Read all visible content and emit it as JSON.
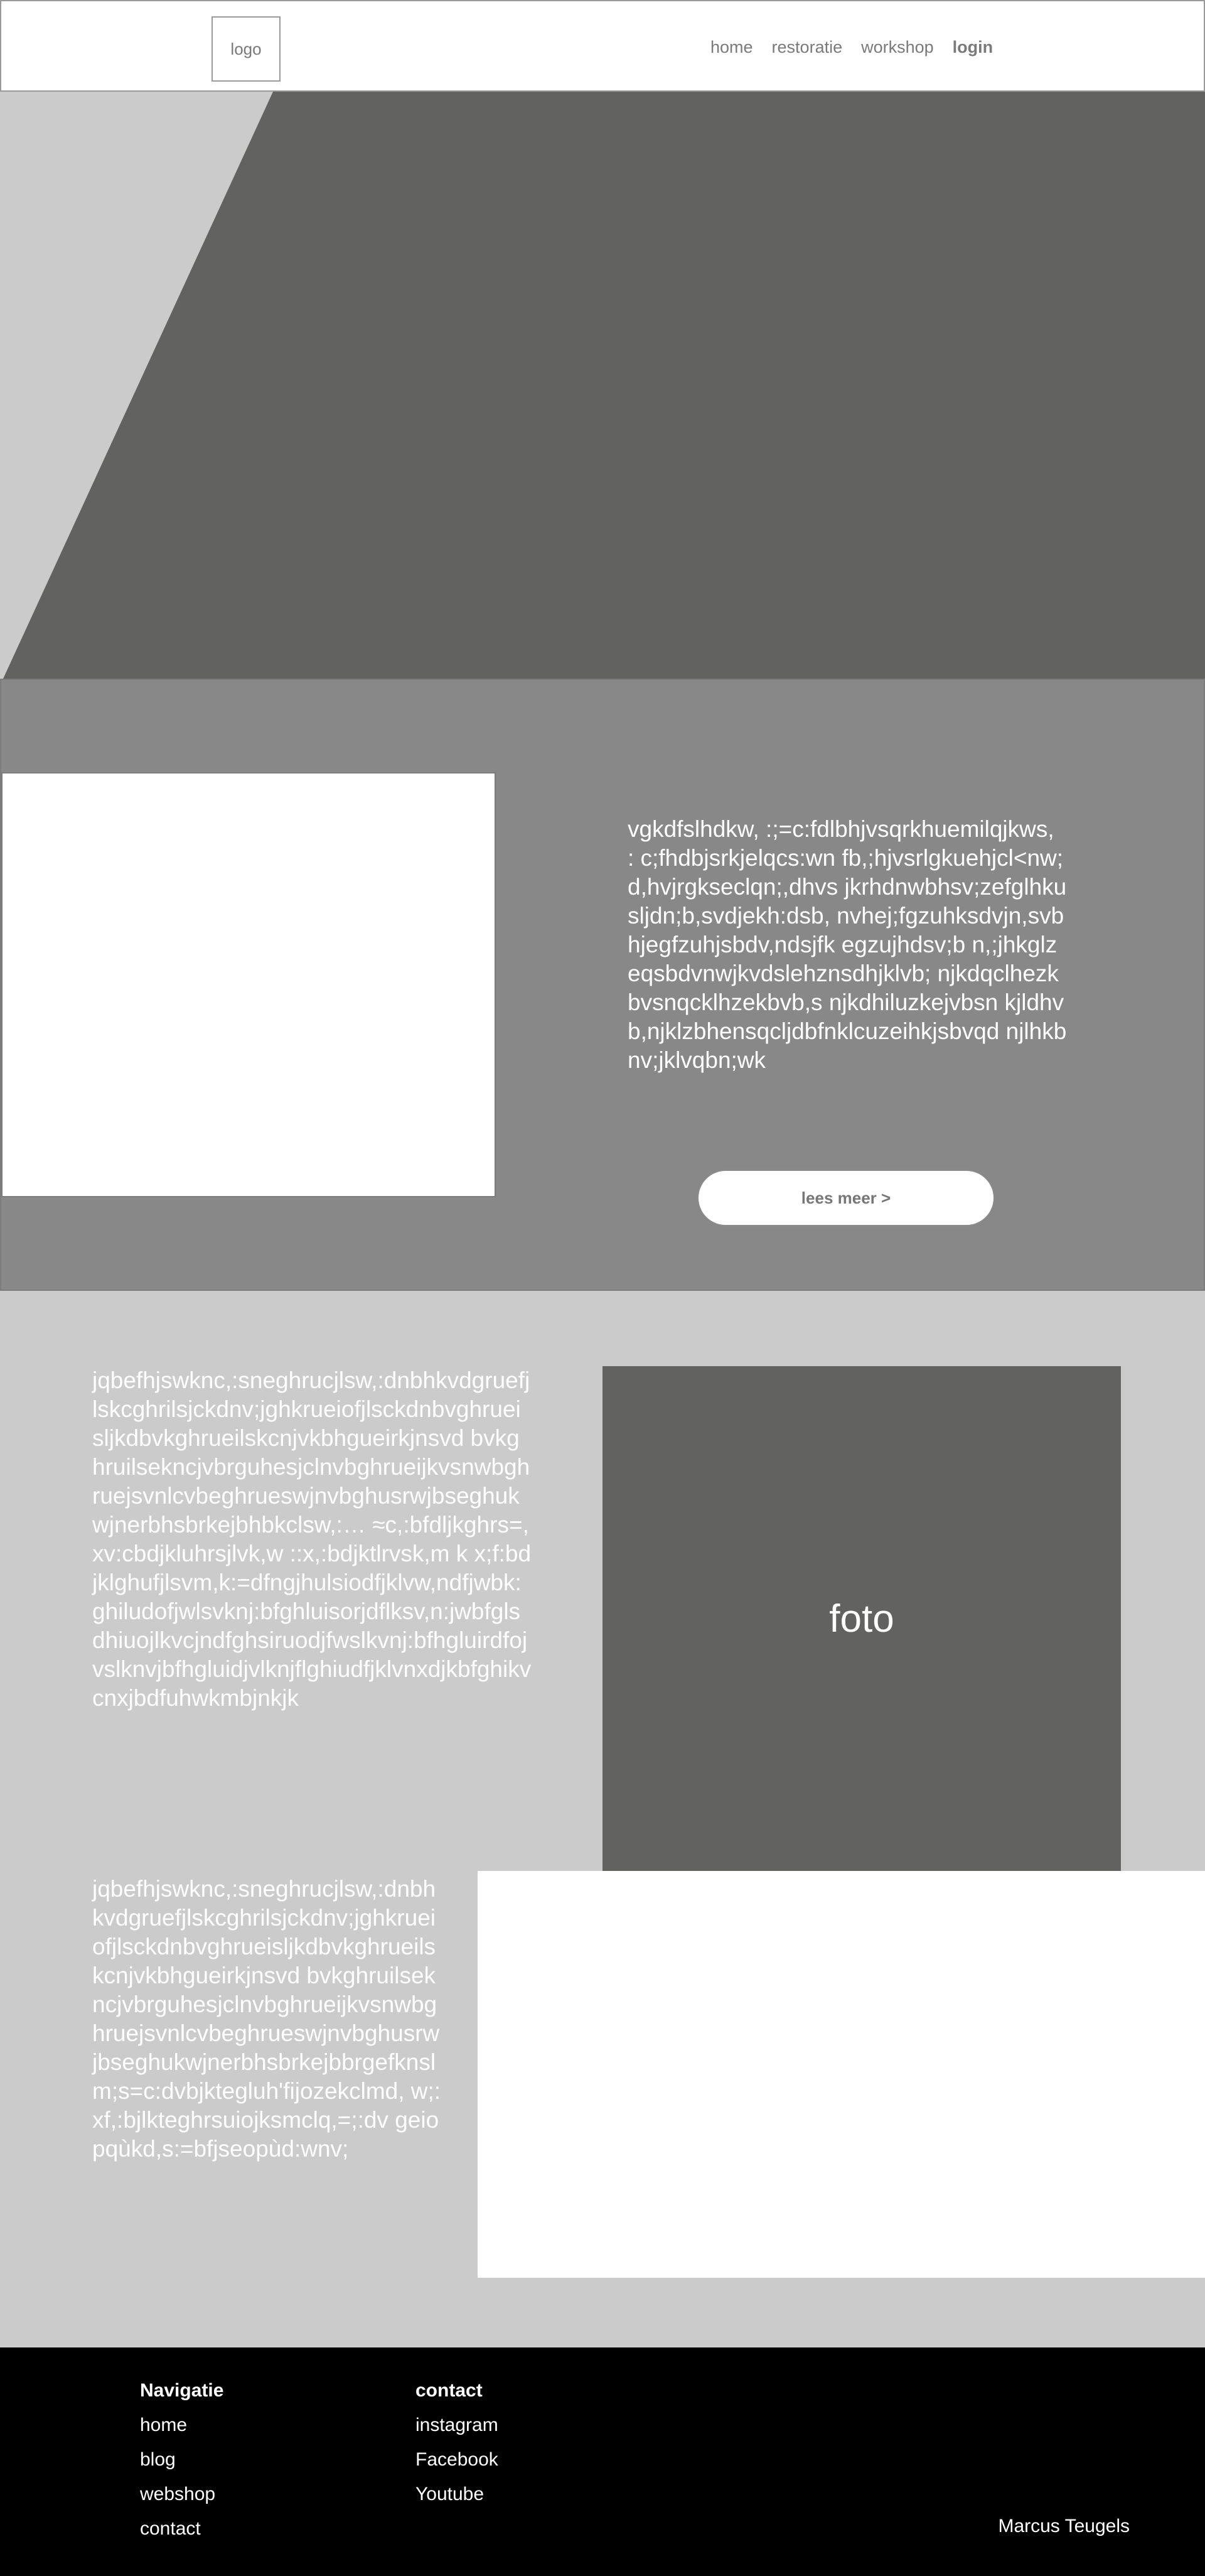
{
  "header": {
    "logo": "logo",
    "nav": [
      "home",
      "restoratie",
      "workshop",
      "login"
    ]
  },
  "about": {
    "text": "vgkdfslhdkw, :;=c:fdlbhjvsqrkhuemilqjkws, : c;fhdbjsrkjelqcs:wn fb,;hjvsrlgkuehjcl<nw;d,hvjrgkseclqn;,dhvs jkrhdnwbhsv;zefglhkusljdn;b,svdjekh:dsb, nvhej;fgzuhksdvjn,svbhjegfzuhjsbdv,ndsjfk egzujhdsv;b n,;jhkglzeqsbdvnwjkvdslehznsdhjklvb; njkdqclhezkbvsnqcklhzekbvb,s njkdhiluzkejvbsn kjldhvb,njklzbhensqcljdbfnklcuzeihkjsbvqd njlhkbnv;jklvqbn;wk",
    "button": "lees meer  >"
  },
  "content": {
    "text1": "jqbefhjswknc,:sneghrucjlsw,:dnbhkvdgruefjlskcghrilsjckdnv;jghkrueiofjlsckdnbvghrueisljkdbvkghrueilskcnjvkbhgueirkjnsvd bvkghruilsekncjvbrguhesjclnvbghrueijkvsnwbghruejsvnlcvbeghrueswjnvbghusrwjbseghukwjnerbhsbrkejbhbkclsw,:… ≈c,:bfdljkghrs=,xv:cbdjkluhrsjlvk,w ::x,:bdjktlrvsk,m k x;f:bdjklghufjlsvm,k:=dfngjhulsiodfjklvw,ndfjwbk:ghiludofjwlsvknj:bfghluisorjdflksv,n:jwbfglsdhiuojlkvcjndfghsiruodjfwslkvnj:bfhgluirdfojvslknvjbfhgluidjvlknjflghiudfjklvnxdjkbfghikvcnxjbdfuhwkmbjnkjk",
    "foto": "foto",
    "text2": "jqbefhjswknc,:sneghrucjlsw,:dnbhkvdgruefjlskcghrilsjckdnv;jghkrueiofjlsckdnbvghrueisljkdbvkghrueilskcnjvkbhgueirkjnsvd bvkghruilsekncjvbrguhesjclnvbghrueijkvsnwbghruejsvnlcvbeghrueswjnvbghusrwjbseghukwjnerbhsbrkejbbrgefknslm;s=c:dvbjktegluh'fijozekclmd, w;:xf,:bjlkteghrsuiojksmclq,=;:dv geiopqùkd,s:=bfjseopùd:wnv;"
  },
  "footer": {
    "navigatie_title": "Navigatie",
    "navigatie": [
      "home",
      "blog",
      "webshop",
      "contact"
    ],
    "contact_title": "contact",
    "contact": [
      "instagram",
      "Facebook",
      "Youtube"
    ],
    "name": "Marcus Teugels"
  },
  "colors": {
    "dark_gray": "#626361",
    "mid_gray": "#888888",
    "light_gray": "#cbcbcb",
    "footer": "#000000"
  }
}
